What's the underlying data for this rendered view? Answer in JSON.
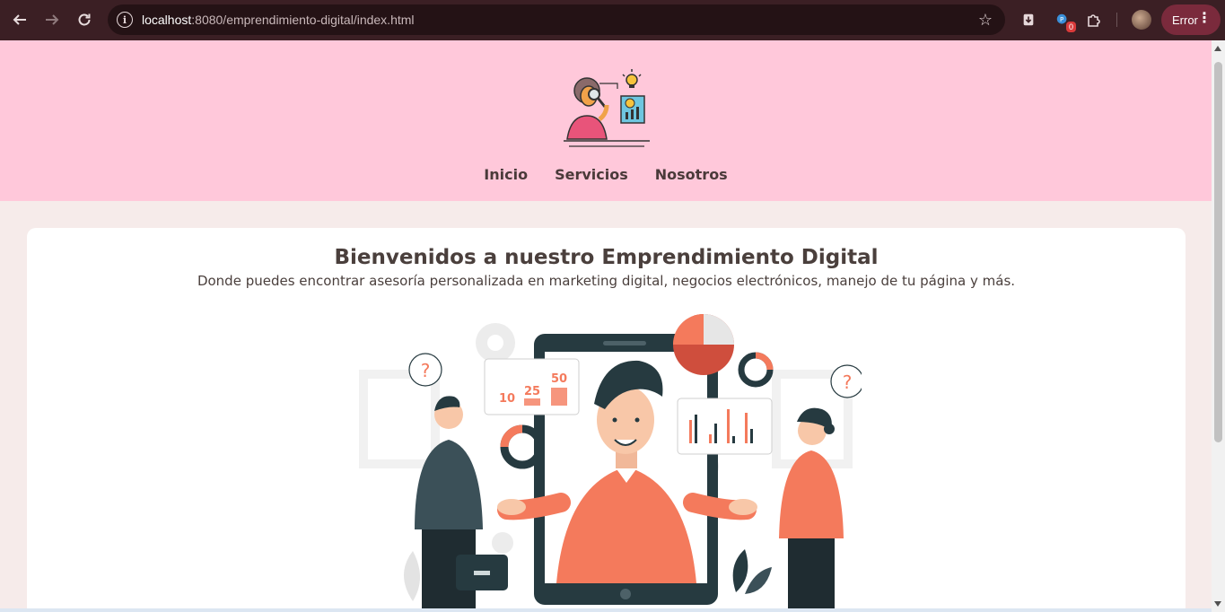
{
  "browser": {
    "url_host": "localhost",
    "url_rest": ":8080/emprendimiento-digital/index.html",
    "profile_label": "Error",
    "extension_badge": "0"
  },
  "header": {
    "nav": [
      {
        "label": "Inicio"
      },
      {
        "label": "Servicios"
      },
      {
        "label": "Nosotros"
      }
    ]
  },
  "hero": {
    "title": "Bienvenidos a nuestro Emprendimiento Digital",
    "subtitle": "Donde puedes encontrar asesoría personalizada en marketing digital, negocios electrónicos, manejo de tu página y más.",
    "stat_labels": [
      "10",
      "25",
      "50"
    ]
  },
  "colors": {
    "header_bg": "#ffc8da",
    "page_bg": "#f6ebea",
    "accent": "#f47a5c",
    "dark": "#263a40",
    "chrome_bg": "#3b1f24"
  }
}
